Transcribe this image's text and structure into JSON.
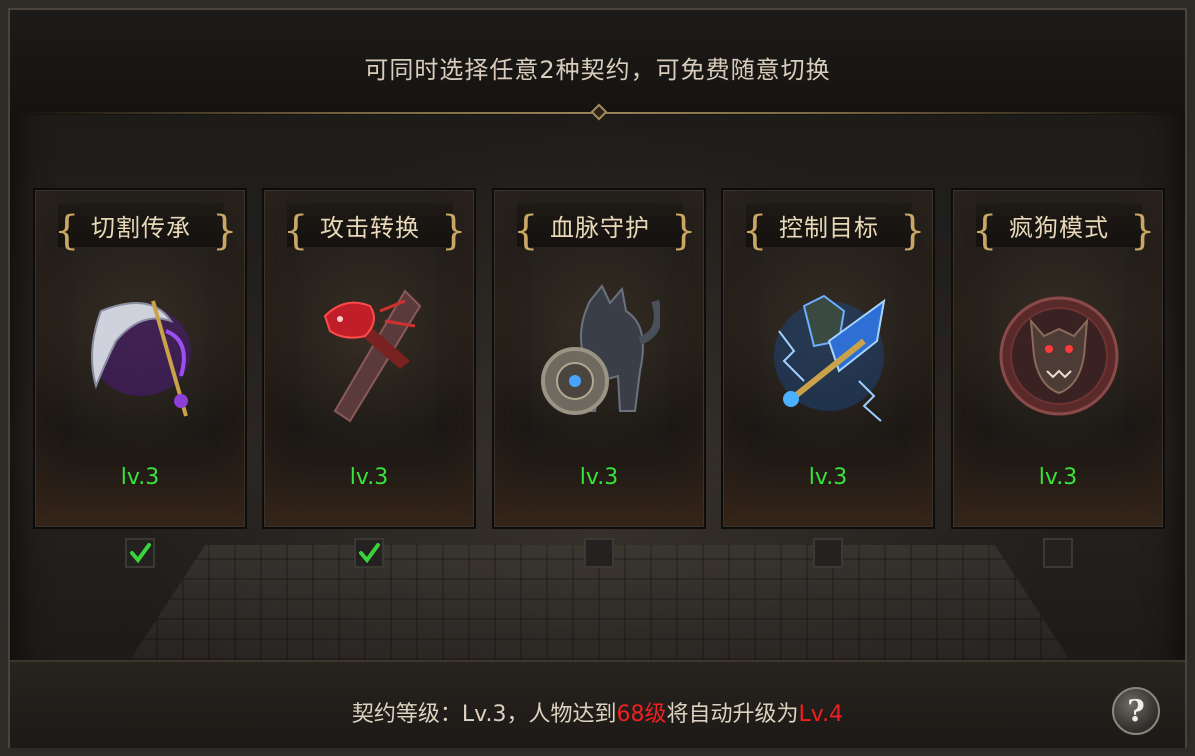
{
  "header": {
    "text": "可同时选择任意2种契约，可免费随意切换"
  },
  "cards": [
    {
      "title": "切割传承",
      "level": "lv.3",
      "checked": true,
      "icon": "purple-scythe-icon"
    },
    {
      "title": "攻击转换",
      "level": "lv.3",
      "checked": true,
      "icon": "red-dragon-sword-icon"
    },
    {
      "title": "血脉守护",
      "level": "lv.3",
      "checked": false,
      "icon": "wolf-shield-icon"
    },
    {
      "title": "控制目标",
      "level": "lv.3",
      "checked": false,
      "icon": "blue-lightning-beast-icon"
    },
    {
      "title": "疯狗模式",
      "level": "lv.3",
      "checked": false,
      "icon": "mad-dog-emblem-icon"
    }
  ],
  "footer": {
    "prefix": "契约等级：Lv.3，人物达到",
    "level_req": "68级",
    "middle": "将自动升级为",
    "next_level": "Lv.4"
  },
  "help": {
    "label": "?"
  },
  "colors": {
    "level_green": "#38e43a",
    "highlight_red": "#ee2020",
    "title_gold": "#e8d9b8",
    "check_green": "#3bd33b"
  }
}
